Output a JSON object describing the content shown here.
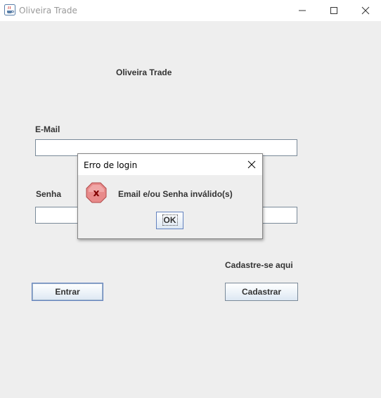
{
  "window": {
    "title": "Oliveira Trade",
    "icons": {
      "app": "java-cup-icon",
      "minimize": "minimize-icon",
      "maximize": "maximize-icon",
      "close": "close-icon"
    }
  },
  "form": {
    "heading": "Oliveira Trade",
    "email_label": "E-Mail",
    "email_value": "",
    "senha_label": "Senha",
    "senha_value": "",
    "cadastre_label": "Cadastre-se aqui",
    "entrar_label": "Entrar",
    "cadastrar_label": "Cadastrar"
  },
  "dialog": {
    "title": "Erro de login",
    "message": "Email e/ou Senha inválido(s)",
    "ok_label": "OK",
    "icon": "error-icon"
  },
  "colors": {
    "error_red": "#e07070",
    "button_border": "#7a8a99",
    "focus_border": "#6382bf"
  }
}
